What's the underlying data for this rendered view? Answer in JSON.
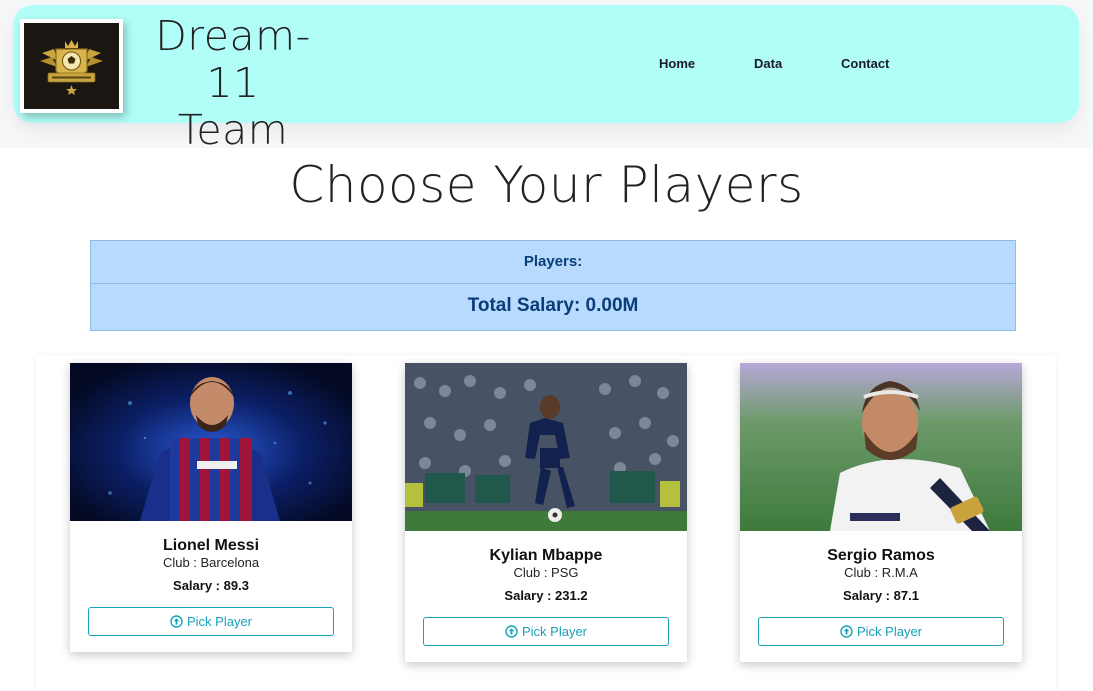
{
  "header": {
    "brand_line1": "Dream-11",
    "brand_line2": "Team",
    "nav": [
      {
        "label": "Home"
      },
      {
        "label": "Data"
      },
      {
        "label": "Contact"
      }
    ]
  },
  "main": {
    "title": "Choose Your Players",
    "summary": {
      "players_label": "Players:",
      "total_salary": "Total Salary: 0.00M"
    },
    "players": [
      {
        "name": "Lionel Messi",
        "club": "Club : Barcelona",
        "salary_label": "Salary :",
        "salary": "89.3",
        "button": "Pick Player",
        "button_icon": "arrow-circle-up-icon"
      },
      {
        "name": "Kylian Mbappe",
        "club": "Club : PSG",
        "salary_label": "Salary :",
        "salary": "231.2",
        "button": "Pick Player",
        "button_icon": "arrow-circle-up-icon"
      },
      {
        "name": "Sergio Ramos",
        "club": "Club : R.M.A",
        "salary_label": "Salary :",
        "salary": "87.1",
        "button": "Pick Player",
        "button_icon": "arrow-circle-up-icon"
      }
    ]
  },
  "colors": {
    "header_bg": "#b1fdf7",
    "summary_bg": "#b8daff",
    "summary_text": "#0b3d78",
    "button_accent": "#17a2b8"
  }
}
